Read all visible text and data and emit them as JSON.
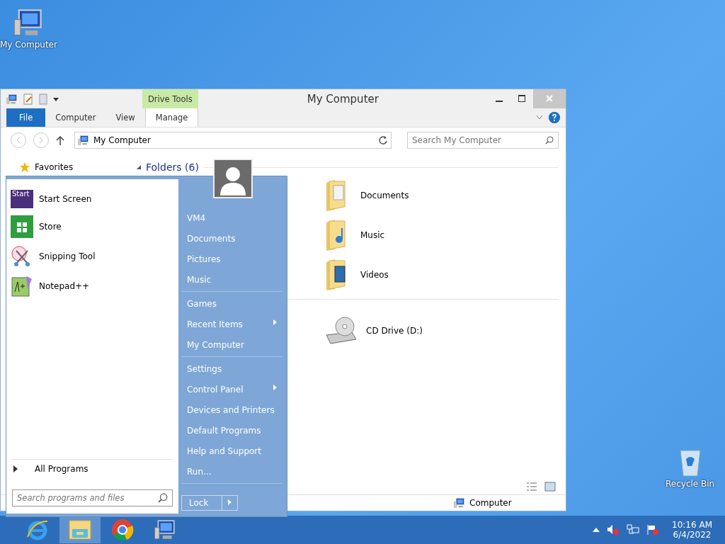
{
  "desktop_icons": [
    {
      "label": "My Computer",
      "kind": "computer"
    },
    {
      "label": "Recycle Bin",
      "kind": "bin"
    }
  ],
  "explorer": {
    "title": "My Computer",
    "context_tab": "Drive Tools",
    "tabs": [
      {
        "label": "File",
        "kind": "file"
      },
      {
        "label": "Computer",
        "kind": "plain"
      },
      {
        "label": "View",
        "kind": "plain"
      },
      {
        "label": "Manage",
        "kind": "context"
      }
    ],
    "address": "My Computer",
    "search": {
      "placeholder": "Search My Computer"
    },
    "nav": [
      {
        "label": "Favorites"
      }
    ],
    "sections": [
      {
        "title": "Folders (6)",
        "items": [
          {
            "label": "Documents",
            "kind": "documents"
          },
          {
            "label": "Music",
            "kind": "music"
          },
          {
            "label": "Videos",
            "kind": "videos"
          }
        ]
      },
      {
        "items": [
          {
            "label": "CD Drive (D:)",
            "kind": "cd"
          }
        ]
      }
    ],
    "status": "Computer"
  },
  "start_menu": {
    "programs": [
      {
        "label": "Start Screen",
        "kind": "start",
        "icon_text": "Start"
      },
      {
        "label": "Store",
        "kind": "store"
      },
      {
        "label": "Snipping Tool",
        "kind": "snip"
      },
      {
        "label": "Notepad++",
        "kind": "notepad"
      }
    ],
    "all_programs": "All Programs",
    "search": {
      "placeholder": "Search programs and files"
    },
    "places": [
      [
        {
          "label": "VM4",
          "submenu": false
        },
        {
          "label": "Documents",
          "submenu": false
        },
        {
          "label": "Pictures",
          "submenu": false
        },
        {
          "label": "Music",
          "submenu": false
        }
      ],
      [
        {
          "label": "Games",
          "submenu": false
        },
        {
          "label": "Recent Items",
          "submenu": true
        },
        {
          "label": "My Computer",
          "submenu": false
        }
      ],
      [
        {
          "label": "Settings",
          "submenu": false
        },
        {
          "label": "Control Panel",
          "submenu": true
        },
        {
          "label": "Devices and Printers",
          "submenu": false
        },
        {
          "label": "Default Programs",
          "submenu": false
        },
        {
          "label": "Help and Support",
          "submenu": false
        },
        {
          "label": "Run...",
          "submenu": false
        }
      ]
    ],
    "lock": "Lock"
  },
  "taskbar": {
    "apps": [
      {
        "kind": "ie",
        "selected": false
      },
      {
        "kind": "explorer",
        "selected": true
      },
      {
        "kind": "chrome",
        "selected": false
      },
      {
        "kind": "computer",
        "selected": false
      }
    ],
    "time": "10:16 AM",
    "date": "6/4/2022"
  }
}
